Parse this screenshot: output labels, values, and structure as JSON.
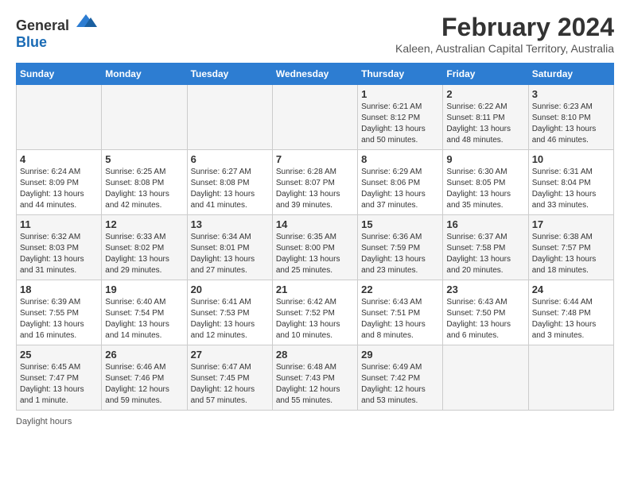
{
  "logo": {
    "general": "General",
    "blue": "Blue"
  },
  "title": "February 2024",
  "subtitle": "Kaleen, Australian Capital Territory, Australia",
  "headers": [
    "Sunday",
    "Monday",
    "Tuesday",
    "Wednesday",
    "Thursday",
    "Friday",
    "Saturday"
  ],
  "weeks": [
    [
      {
        "day": "",
        "info": ""
      },
      {
        "day": "",
        "info": ""
      },
      {
        "day": "",
        "info": ""
      },
      {
        "day": "",
        "info": ""
      },
      {
        "day": "1",
        "info": "Sunrise: 6:21 AM\nSunset: 8:12 PM\nDaylight: 13 hours and 50 minutes."
      },
      {
        "day": "2",
        "info": "Sunrise: 6:22 AM\nSunset: 8:11 PM\nDaylight: 13 hours and 48 minutes."
      },
      {
        "day": "3",
        "info": "Sunrise: 6:23 AM\nSunset: 8:10 PM\nDaylight: 13 hours and 46 minutes."
      }
    ],
    [
      {
        "day": "4",
        "info": "Sunrise: 6:24 AM\nSunset: 8:09 PM\nDaylight: 13 hours and 44 minutes."
      },
      {
        "day": "5",
        "info": "Sunrise: 6:25 AM\nSunset: 8:08 PM\nDaylight: 13 hours and 42 minutes."
      },
      {
        "day": "6",
        "info": "Sunrise: 6:27 AM\nSunset: 8:08 PM\nDaylight: 13 hours and 41 minutes."
      },
      {
        "day": "7",
        "info": "Sunrise: 6:28 AM\nSunset: 8:07 PM\nDaylight: 13 hours and 39 minutes."
      },
      {
        "day": "8",
        "info": "Sunrise: 6:29 AM\nSunset: 8:06 PM\nDaylight: 13 hours and 37 minutes."
      },
      {
        "day": "9",
        "info": "Sunrise: 6:30 AM\nSunset: 8:05 PM\nDaylight: 13 hours and 35 minutes."
      },
      {
        "day": "10",
        "info": "Sunrise: 6:31 AM\nSunset: 8:04 PM\nDaylight: 13 hours and 33 minutes."
      }
    ],
    [
      {
        "day": "11",
        "info": "Sunrise: 6:32 AM\nSunset: 8:03 PM\nDaylight: 13 hours and 31 minutes."
      },
      {
        "day": "12",
        "info": "Sunrise: 6:33 AM\nSunset: 8:02 PM\nDaylight: 13 hours and 29 minutes."
      },
      {
        "day": "13",
        "info": "Sunrise: 6:34 AM\nSunset: 8:01 PM\nDaylight: 13 hours and 27 minutes."
      },
      {
        "day": "14",
        "info": "Sunrise: 6:35 AM\nSunset: 8:00 PM\nDaylight: 13 hours and 25 minutes."
      },
      {
        "day": "15",
        "info": "Sunrise: 6:36 AM\nSunset: 7:59 PM\nDaylight: 13 hours and 23 minutes."
      },
      {
        "day": "16",
        "info": "Sunrise: 6:37 AM\nSunset: 7:58 PM\nDaylight: 13 hours and 20 minutes."
      },
      {
        "day": "17",
        "info": "Sunrise: 6:38 AM\nSunset: 7:57 PM\nDaylight: 13 hours and 18 minutes."
      }
    ],
    [
      {
        "day": "18",
        "info": "Sunrise: 6:39 AM\nSunset: 7:55 PM\nDaylight: 13 hours and 16 minutes."
      },
      {
        "day": "19",
        "info": "Sunrise: 6:40 AM\nSunset: 7:54 PM\nDaylight: 13 hours and 14 minutes."
      },
      {
        "day": "20",
        "info": "Sunrise: 6:41 AM\nSunset: 7:53 PM\nDaylight: 13 hours and 12 minutes."
      },
      {
        "day": "21",
        "info": "Sunrise: 6:42 AM\nSunset: 7:52 PM\nDaylight: 13 hours and 10 minutes."
      },
      {
        "day": "22",
        "info": "Sunrise: 6:43 AM\nSunset: 7:51 PM\nDaylight: 13 hours and 8 minutes."
      },
      {
        "day": "23",
        "info": "Sunrise: 6:43 AM\nSunset: 7:50 PM\nDaylight: 13 hours and 6 minutes."
      },
      {
        "day": "24",
        "info": "Sunrise: 6:44 AM\nSunset: 7:48 PM\nDaylight: 13 hours and 3 minutes."
      }
    ],
    [
      {
        "day": "25",
        "info": "Sunrise: 6:45 AM\nSunset: 7:47 PM\nDaylight: 13 hours and 1 minute."
      },
      {
        "day": "26",
        "info": "Sunrise: 6:46 AM\nSunset: 7:46 PM\nDaylight: 12 hours and 59 minutes."
      },
      {
        "day": "27",
        "info": "Sunrise: 6:47 AM\nSunset: 7:45 PM\nDaylight: 12 hours and 57 minutes."
      },
      {
        "day": "28",
        "info": "Sunrise: 6:48 AM\nSunset: 7:43 PM\nDaylight: 12 hours and 55 minutes."
      },
      {
        "day": "29",
        "info": "Sunrise: 6:49 AM\nSunset: 7:42 PM\nDaylight: 12 hours and 53 minutes."
      },
      {
        "day": "",
        "info": ""
      },
      {
        "day": "",
        "info": ""
      }
    ]
  ],
  "footer": "Daylight hours"
}
